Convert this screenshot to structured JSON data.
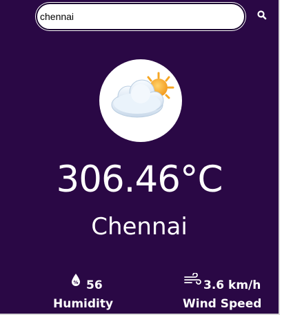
{
  "search": {
    "value": "chennai",
    "icon": "search-icon"
  },
  "weather": {
    "icon": "sun-behind-cloud-icon",
    "temperature": "306.46°C",
    "city": "Chennai"
  },
  "details": {
    "humidity": {
      "icon": "humidity-icon",
      "value": "56",
      "label": "Humidity"
    },
    "wind": {
      "icon": "wind-icon",
      "value": "3.6 km/h",
      "label": "Wind Speed"
    }
  },
  "colors": {
    "background": "#2a0845",
    "text": "#ffffff",
    "sun": "#f6a623"
  }
}
